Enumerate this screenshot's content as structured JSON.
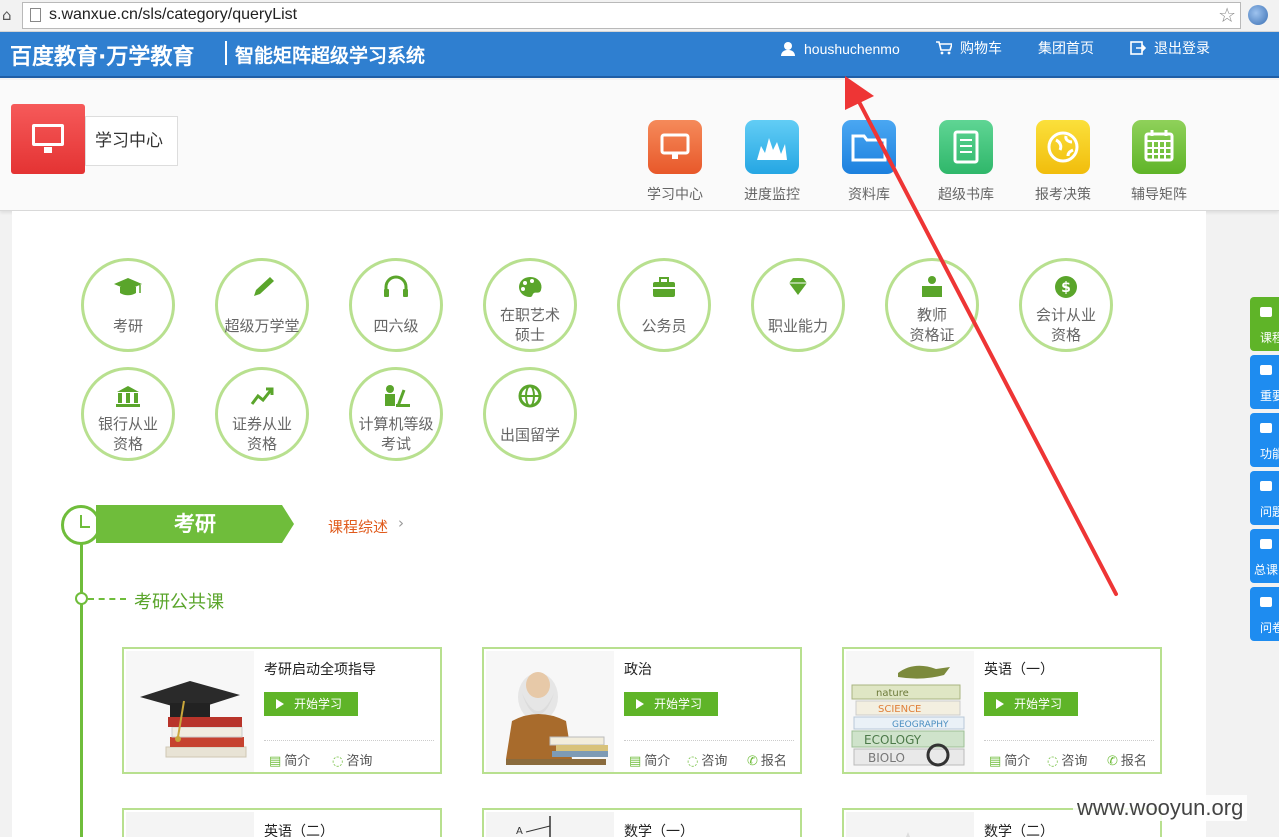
{
  "browser": {
    "url": "s.wanxue.cn/sls/category/queryList"
  },
  "header": {
    "brand": "百度教育·万学教育",
    "subtitle": "智能矩阵超级学习系统",
    "username": "houshuchenmo",
    "cart": "购物车",
    "group_home": "集团首页",
    "logout": "退出登录"
  },
  "learning_center_label": "学习中心",
  "apps": [
    {
      "label": "学习中心",
      "icon": "monitor-icon",
      "color": "#f06b3b"
    },
    {
      "label": "进度监控",
      "icon": "chart-icon",
      "color": "#36b4ea"
    },
    {
      "label": "资料库",
      "icon": "folder-icon",
      "color": "#2a8fe8"
    },
    {
      "label": "超级书库",
      "icon": "book-icon",
      "color": "#3fc07a"
    },
    {
      "label": "报考决策",
      "icon": "globe-icon",
      "color": "#f5c81e"
    },
    {
      "label": "辅导矩阵",
      "icon": "calendar-icon",
      "color": "#72bf3a"
    }
  ],
  "categories": [
    {
      "line1": "考研",
      "line2": "",
      "icon": "graduation-cap-icon"
    },
    {
      "line1": "超级万学堂",
      "line2": "",
      "icon": "pencil-icon"
    },
    {
      "line1": "四六级",
      "line2": "",
      "icon": "headphones-icon"
    },
    {
      "line1": "在职艺术",
      "line2": "硕士",
      "icon": "palette-icon"
    },
    {
      "line1": "公务员",
      "line2": "",
      "icon": "briefcase-icon"
    },
    {
      "line1": "职业能力",
      "line2": "",
      "icon": "diamond-icon"
    },
    {
      "line1": "教师",
      "line2": "资格证",
      "icon": "teacher-icon"
    },
    {
      "line1": "会计从业",
      "line2": "资格",
      "icon": "dollar-icon"
    },
    {
      "line1": "银行从业",
      "line2": "资格",
      "icon": "bank-icon"
    },
    {
      "line1": "证券从业",
      "line2": "资格",
      "icon": "trend-icon"
    },
    {
      "line1": "计算机等级",
      "line2": "考试",
      "icon": "computer-user-icon"
    },
    {
      "line1": "出国留学",
      "line2": "",
      "icon": "globe-icon"
    }
  ],
  "section": {
    "title": "考研",
    "overview_link": "课程综述",
    "subsection": "考研公共课"
  },
  "courses": [
    {
      "title": "考研启动全项指导",
      "start": "开始学习",
      "intro": "简介",
      "consult": "咨询",
      "signup": ""
    },
    {
      "title": "政治",
      "start": "开始学习",
      "intro": "简介",
      "consult": "咨询",
      "signup": "报名"
    },
    {
      "title": "英语（一）",
      "start": "开始学习",
      "intro": "简介",
      "consult": "咨询",
      "signup": "报名"
    }
  ],
  "courses_row2": [
    {
      "title": "英语（二）"
    },
    {
      "title": "数学（一）"
    },
    {
      "title": "数学（二）"
    }
  ],
  "sidetabs": [
    "课程",
    "重要",
    "功能",
    "问题",
    "总课",
    "问卷"
  ],
  "watermark": "www.wooyun.org"
}
